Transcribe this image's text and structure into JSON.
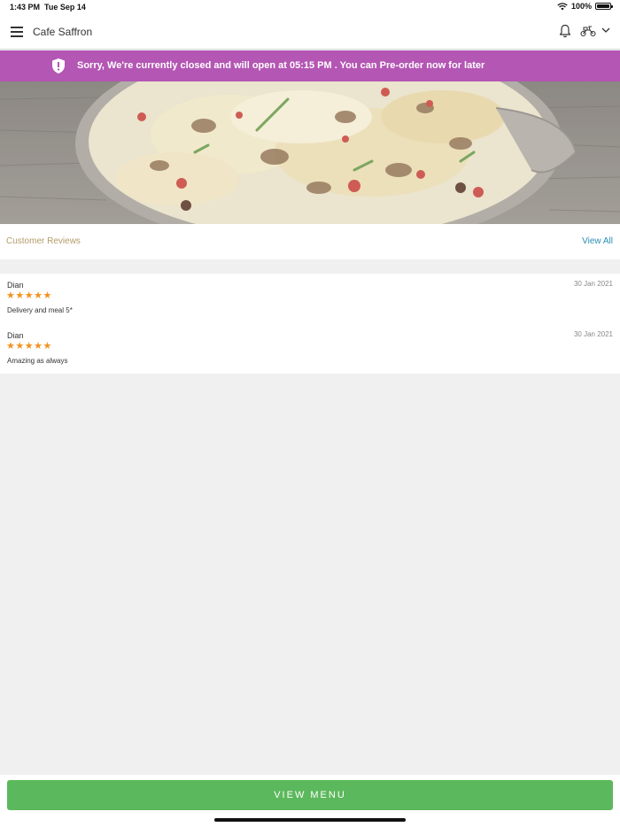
{
  "status_bar": {
    "time": "1:43 PM",
    "date": "Tue Sep 14",
    "battery": "100%"
  },
  "header": {
    "title": "Cafe Saffron"
  },
  "banner": {
    "message": "Sorry, We're currently closed and will open at 05:15 PM . You can Pre-order now for later",
    "color": "#b456b4"
  },
  "reviews": {
    "heading": "Customer Reviews",
    "view_all": "View All",
    "items": [
      {
        "name": "Dian",
        "date": "30 Jan 2021",
        "stars": "★★★★★",
        "rating": 5,
        "text": "Delivery and meal 5*"
      },
      {
        "name": "Dian",
        "date": "30 Jan 2021",
        "stars": "★★★★★",
        "rating": 5,
        "text": "Amazing as always"
      }
    ]
  },
  "actions": {
    "view_menu": "VIEW MENU"
  },
  "colors": {
    "accent_green": "#5cb85c",
    "star": "#f2921f",
    "link": "#2a8fb3"
  }
}
